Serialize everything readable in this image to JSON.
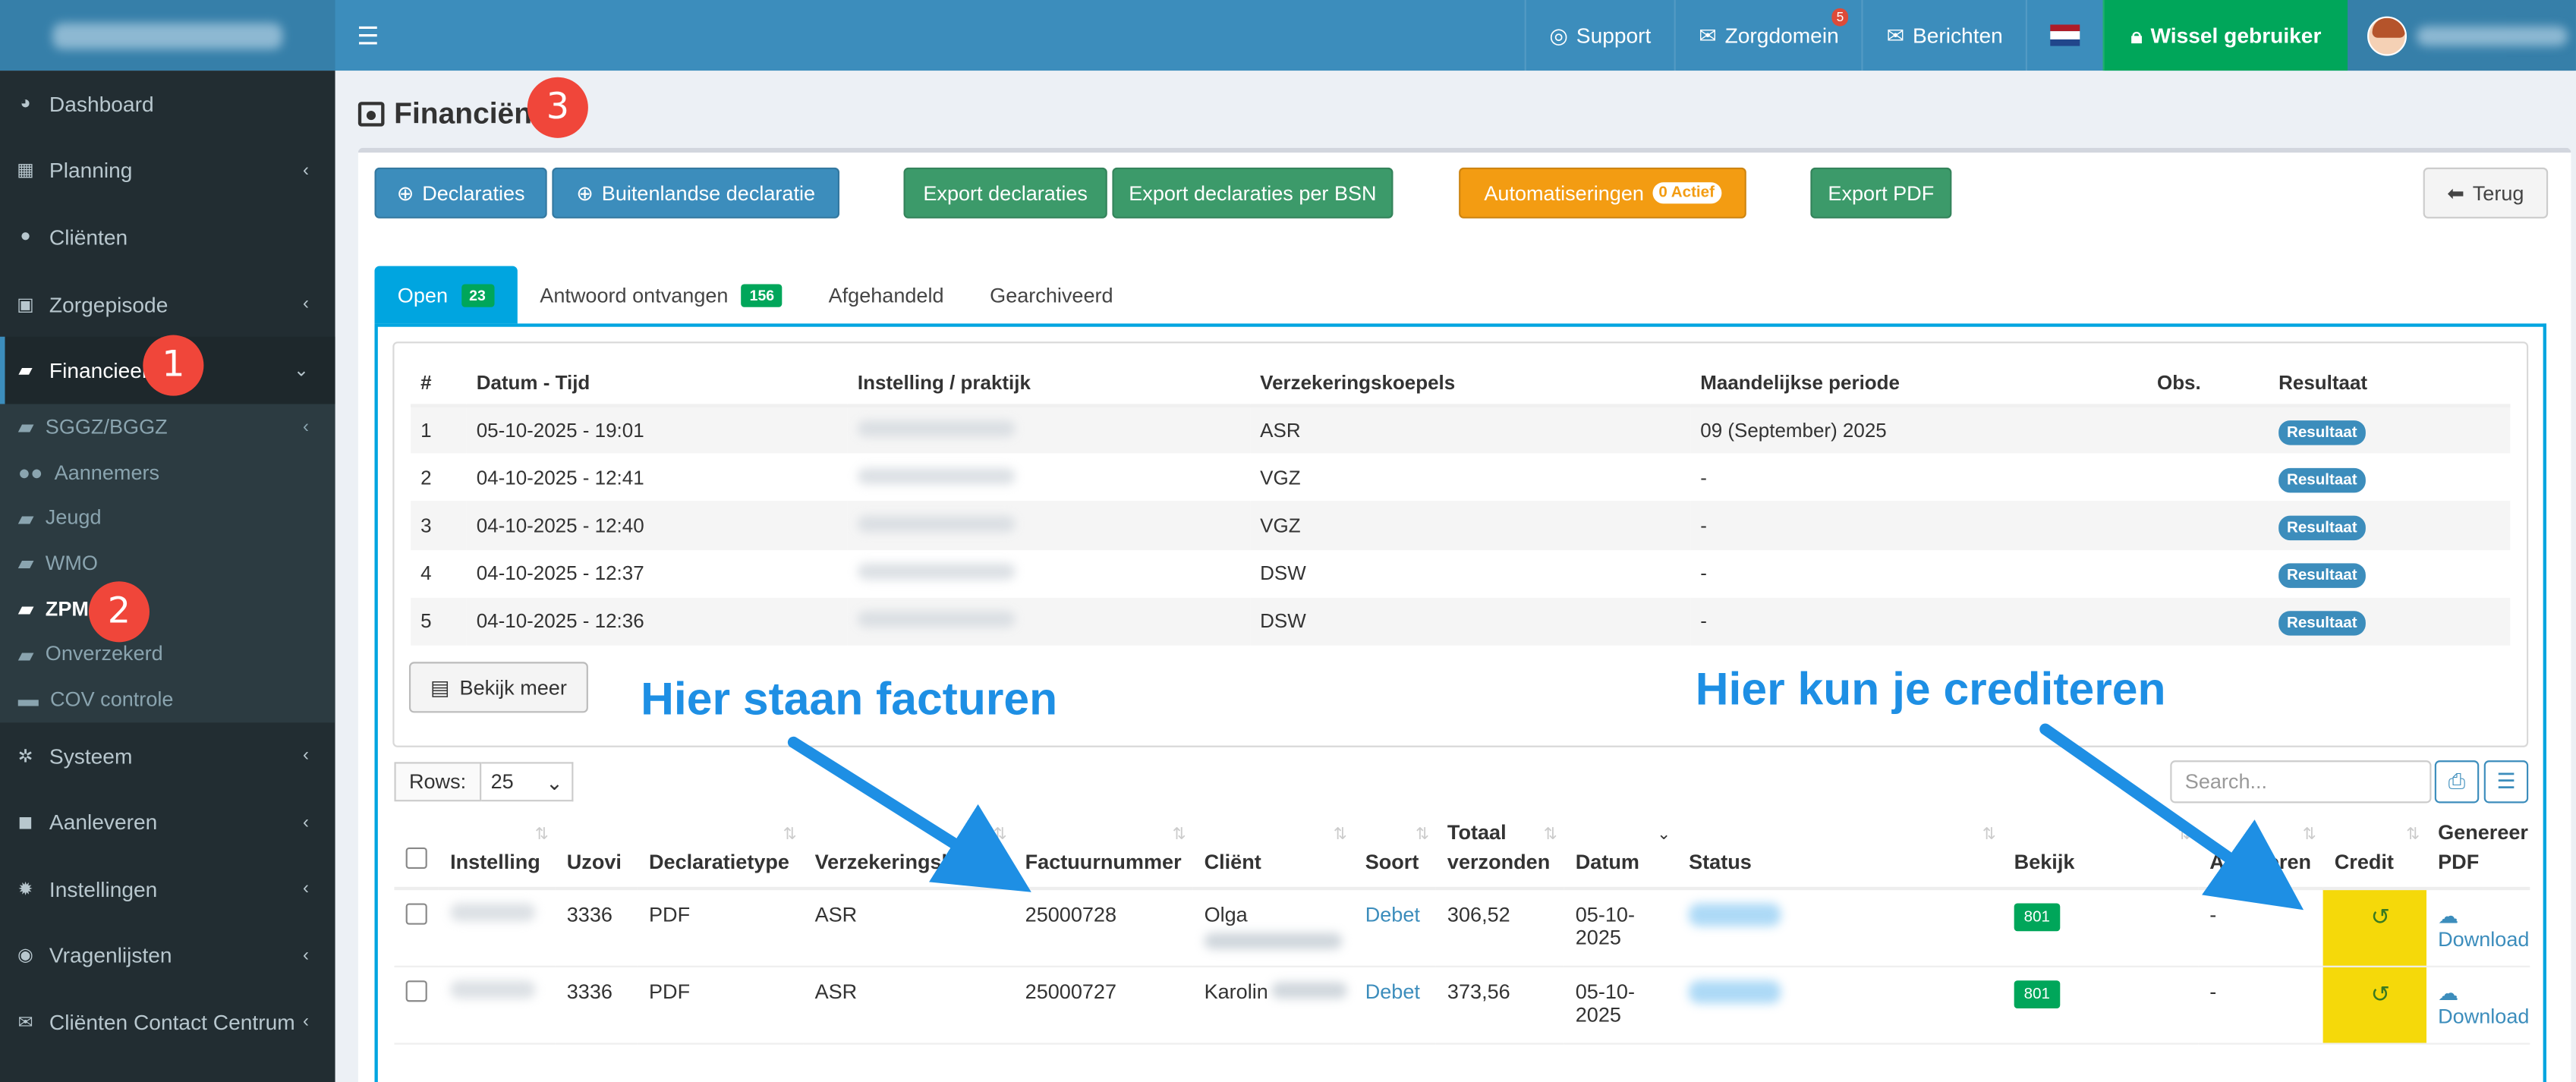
{
  "topbar": {
    "support": "Support",
    "zorgdomein": "Zorgdomein",
    "zorgdomein_badge": "5",
    "berichten": "Berichten",
    "wissel": "Wissel gebruiker"
  },
  "sidebar": {
    "items": [
      {
        "label": "Dashboard"
      },
      {
        "label": "Planning"
      },
      {
        "label": "Cliënten"
      },
      {
        "label": "Zorgepisode"
      },
      {
        "label": "Financieel"
      },
      {
        "label": "Systeem"
      },
      {
        "label": "Aanleveren"
      },
      {
        "label": "Instellingen"
      },
      {
        "label": "Vragenlijsten"
      },
      {
        "label": "Cliënten Contact Centrum"
      }
    ],
    "sub": [
      {
        "label": "SGGZ/BGGZ"
      },
      {
        "label": "Aannemers"
      },
      {
        "label": "Jeugd"
      },
      {
        "label": "WMO"
      },
      {
        "label": "ZPM"
      },
      {
        "label": "Onverzekerd"
      },
      {
        "label": "COV controle"
      }
    ]
  },
  "markers": [
    "1",
    "2",
    "3"
  ],
  "page": {
    "title": "Financiën"
  },
  "toolbar": {
    "declaraties": "Declaraties",
    "buitenlandse": "Buitenlandse declaratie",
    "export_declaraties": "Export declaraties",
    "export_bsn": "Export declaraties per BSN",
    "automatiseringen": "Automatiseringen",
    "actief": "0 Actief",
    "export_pdf": "Export PDF",
    "terug": "Terug"
  },
  "tabs": [
    {
      "label": "Open",
      "count": "23"
    },
    {
      "label": "Antwoord ontvangen",
      "count": "156"
    },
    {
      "label": "Afgehandeld"
    },
    {
      "label": "Gearchiveerd"
    }
  ],
  "batch": {
    "headers": [
      "#",
      "Datum - Tijd",
      "Instelling / praktijk",
      "Verzekeringskoepels",
      "Maandelijkse periode",
      "Obs.",
      "Resultaat"
    ],
    "rows": [
      {
        "n": "1",
        "datum": "05-10-2025 - 19:01",
        "koepel": "ASR",
        "periode": "09 (September) 2025",
        "resultaat": "Resultaat"
      },
      {
        "n": "2",
        "datum": "04-10-2025 - 12:41",
        "koepel": "VGZ",
        "periode": "-",
        "resultaat": "Resultaat"
      },
      {
        "n": "3",
        "datum": "04-10-2025 - 12:40",
        "koepel": "VGZ",
        "periode": "-",
        "resultaat": "Resultaat"
      },
      {
        "n": "4",
        "datum": "04-10-2025 - 12:37",
        "koepel": "DSW",
        "periode": "-",
        "resultaat": "Resultaat"
      },
      {
        "n": "5",
        "datum": "04-10-2025 - 12:36",
        "koepel": "DSW",
        "periode": "-",
        "resultaat": "Resultaat"
      }
    ],
    "more": "Bekijk meer"
  },
  "annotations": {
    "facturen": "Hier staan facturen",
    "crediteren": "Hier kun je crediteren"
  },
  "controls": {
    "rows_label": "Rows:",
    "rows_value": "25",
    "search_placeholder": "Search..."
  },
  "invoices": {
    "headers": {
      "instelling": "Instelling",
      "uzovi": "Uzovi",
      "declaratietype": "Declaratietype",
      "koepel": "Verzekeringskoepels",
      "factuurnummer": "Factuurnummer",
      "client": "Cliënt",
      "soort": "Soort",
      "totaal1": "Totaal",
      "totaal2": "verzonden",
      "datum": "Datum",
      "status": "Status",
      "bekijk": "Bekijk",
      "annuleren": "Annuleren",
      "credit": "Credit",
      "genereer1": "Genereer",
      "genereer2": "PDF"
    },
    "rows": [
      {
        "uzovi": "3336",
        "type": "PDF",
        "koepel": "ASR",
        "factuur": "25000728",
        "client": "Olga",
        "soort": "Debet",
        "totaal": "306,52",
        "datum": "05-10-2025",
        "bekijk": "801",
        "annuleren": "-",
        "download": "Download"
      },
      {
        "uzovi": "3336",
        "type": "PDF",
        "koepel": "ASR",
        "factuur": "25000727",
        "client": "Karolin",
        "soort": "Debet",
        "totaal": "373,56",
        "datum": "05-10-2025",
        "bekijk": "801",
        "annuleren": "-",
        "download": "Download"
      }
    ]
  },
  "colors": {
    "accent": "#3c8dbc",
    "tab_active": "#00a5e0",
    "success": "#00a65a",
    "warning": "#f39c12",
    "marker": "#f0463a",
    "annotation": "#1e8fe4",
    "credit_highlight": "#f5d90a"
  }
}
